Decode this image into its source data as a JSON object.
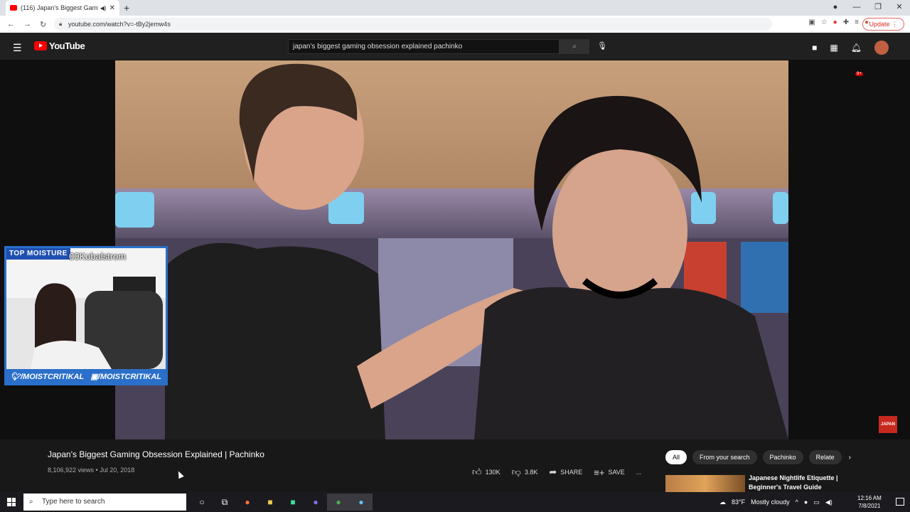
{
  "browser": {
    "tab_title": "(116) Japan's Biggest Gaming",
    "new_tab": "+",
    "url": "youtube.com/watch?v=-tBy2jemw4s",
    "update_label": "Update"
  },
  "youtube": {
    "logo_text": "YouTube",
    "search_query": "japan's biggest gaming obsession explained pachinko",
    "notification_count": "9+"
  },
  "webcam": {
    "top_label": "TOP MOISTURE",
    "username": "00Kobalstrom",
    "twitter": "/MOISTCRITIKAL",
    "twitch": "/MOISTCRITIKAL"
  },
  "video": {
    "title": "Japan's Biggest Gaming Obsession Explained | Pachinko",
    "views": "8,106,922 views",
    "date": "Jul 20, 2018",
    "likes": "130K",
    "dislikes": "3.8K",
    "share_label": "SHARE",
    "save_label": "SAVE",
    "more": "..."
  },
  "chips": [
    "All",
    "From your search",
    "Pachinko",
    "Relate"
  ],
  "recommended": {
    "title": "Japanese Nightlife Etiquette | Beginner's Travel Guide"
  },
  "taskbar": {
    "search_placeholder": "Type here to search",
    "temperature": "83°F",
    "weather": "Mostly cloudy",
    "time": "12:16 AM",
    "date": "7/8/2021"
  }
}
